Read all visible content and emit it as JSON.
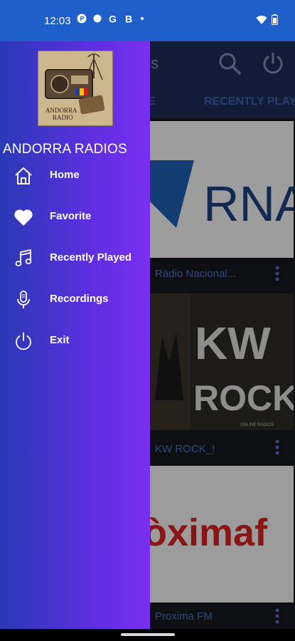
{
  "status": {
    "time": "12:03",
    "icons": [
      "p-icon",
      "dot-icon",
      "google-icon",
      "b-icon",
      "small-dot-icon"
    ],
    "right_icons": [
      "wifi-icon",
      "battery-icon"
    ]
  },
  "app": {
    "title_fragment": "ios",
    "tabs": [
      "E",
      "RECENTLY PLAYE"
    ],
    "stations": [
      {
        "name": "Ràdio Nacional...",
        "logo_text": "RNA"
      },
      {
        "name": "KW ROCK_!",
        "logo_text_1": "KW",
        "logo_text_2": "ROCK",
        "logo_text_3": "ONLINE RADIOS"
      },
      {
        "name": "Proxima FM",
        "logo_text": "òximaf"
      }
    ],
    "colors": {
      "appbar": "#1c2a55",
      "accent": "#4d6fc0"
    }
  },
  "drawer": {
    "logo_text_1": "ANDORRA",
    "logo_text_2": "RADIO",
    "title": "ANDORRA RADIOS",
    "items": [
      {
        "label": "Home",
        "icon": "home-icon"
      },
      {
        "label": "Favorite",
        "icon": "heart-icon"
      },
      {
        "label": "Recently Played",
        "icon": "music-note-icon"
      },
      {
        "label": "Recordings",
        "icon": "microphone-icon"
      },
      {
        "label": "Exit",
        "icon": "power-icon"
      }
    ],
    "gradient": [
      "#2a39b6",
      "#7b2ff0"
    ]
  }
}
